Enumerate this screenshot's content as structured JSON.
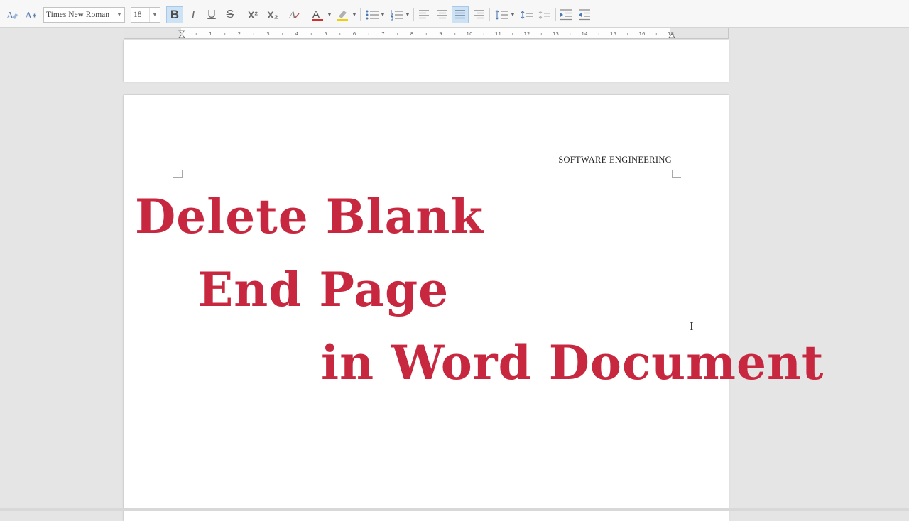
{
  "toolbar": {
    "font_name": "Times New Roman",
    "font_size": "18",
    "bold_label": "B",
    "italic_label": "I",
    "underline_label": "U",
    "strike_label": "S",
    "superscript_label": "X²",
    "subscript_label": "X₂",
    "font_color": "#d0312d",
    "highlight_color": "#f2cf00",
    "alignment_selected": "justify"
  },
  "ruler": {
    "numbers": [
      "1",
      "2",
      "3",
      "4",
      "5",
      "6",
      "7",
      "8",
      "9",
      "10",
      "11",
      "12",
      "13",
      "14",
      "15",
      "16",
      "18"
    ]
  },
  "document": {
    "header_text": "SOFTWARE ENGINEERING"
  },
  "overlay": {
    "line1": "Delete Blank",
    "line2": "End Page",
    "line3": "in Word Document",
    "color": "#c8283f"
  },
  "cursor_glyph": "I"
}
